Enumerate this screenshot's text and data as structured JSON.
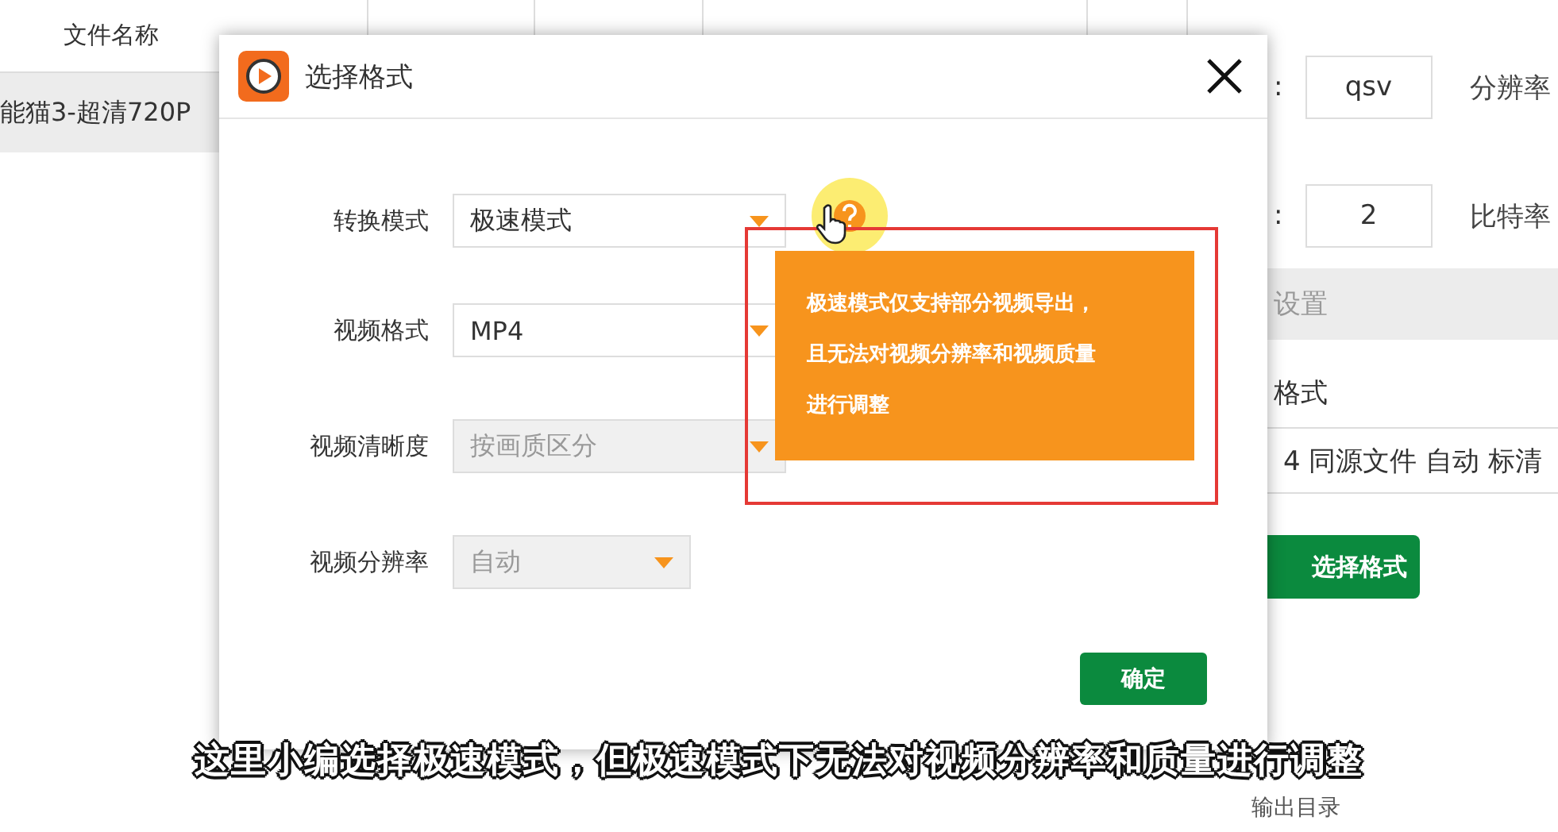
{
  "table": {
    "columns": [
      {
        "label": "文件名称"
      }
    ],
    "rows": [
      {
        "name": "能猫3-超清720P",
        "selected": true
      }
    ]
  },
  "side_panel": {
    "fields": [
      {
        "prefix": ":",
        "value": "qsv",
        "label": "分辨率"
      },
      {
        "prefix": ":",
        "value": "2",
        "label": "比特率"
      }
    ],
    "section": "设置",
    "format_label": "格式",
    "format_value": "4 同源文件 自动 标清",
    "button": "选择格式",
    "output_label": "输出目录"
  },
  "dialog": {
    "title": "选择格式",
    "rows": [
      {
        "label": "转换模式",
        "value": "极速模式",
        "disabled": false,
        "help": true,
        "wide": true
      },
      {
        "label": "视频格式",
        "value": "MP4",
        "disabled": false,
        "help": false,
        "wide": true
      },
      {
        "label": "视频清晰度",
        "value": "按画质区分",
        "disabled": true,
        "help": false,
        "wide": true
      },
      {
        "label": "视频分辨率",
        "value": "自动",
        "disabled": true,
        "help": false,
        "wide": false
      }
    ],
    "tooltip": {
      "lines": [
        "极速模式仅支持部分视频导出，",
        "且无法对视频分辨率和视频质量",
        "进行调整"
      ]
    },
    "confirm": "确定"
  },
  "subtitle": "这里小编选择极速模式，但极速模式下无法对视频分辨率和质量进行调整"
}
